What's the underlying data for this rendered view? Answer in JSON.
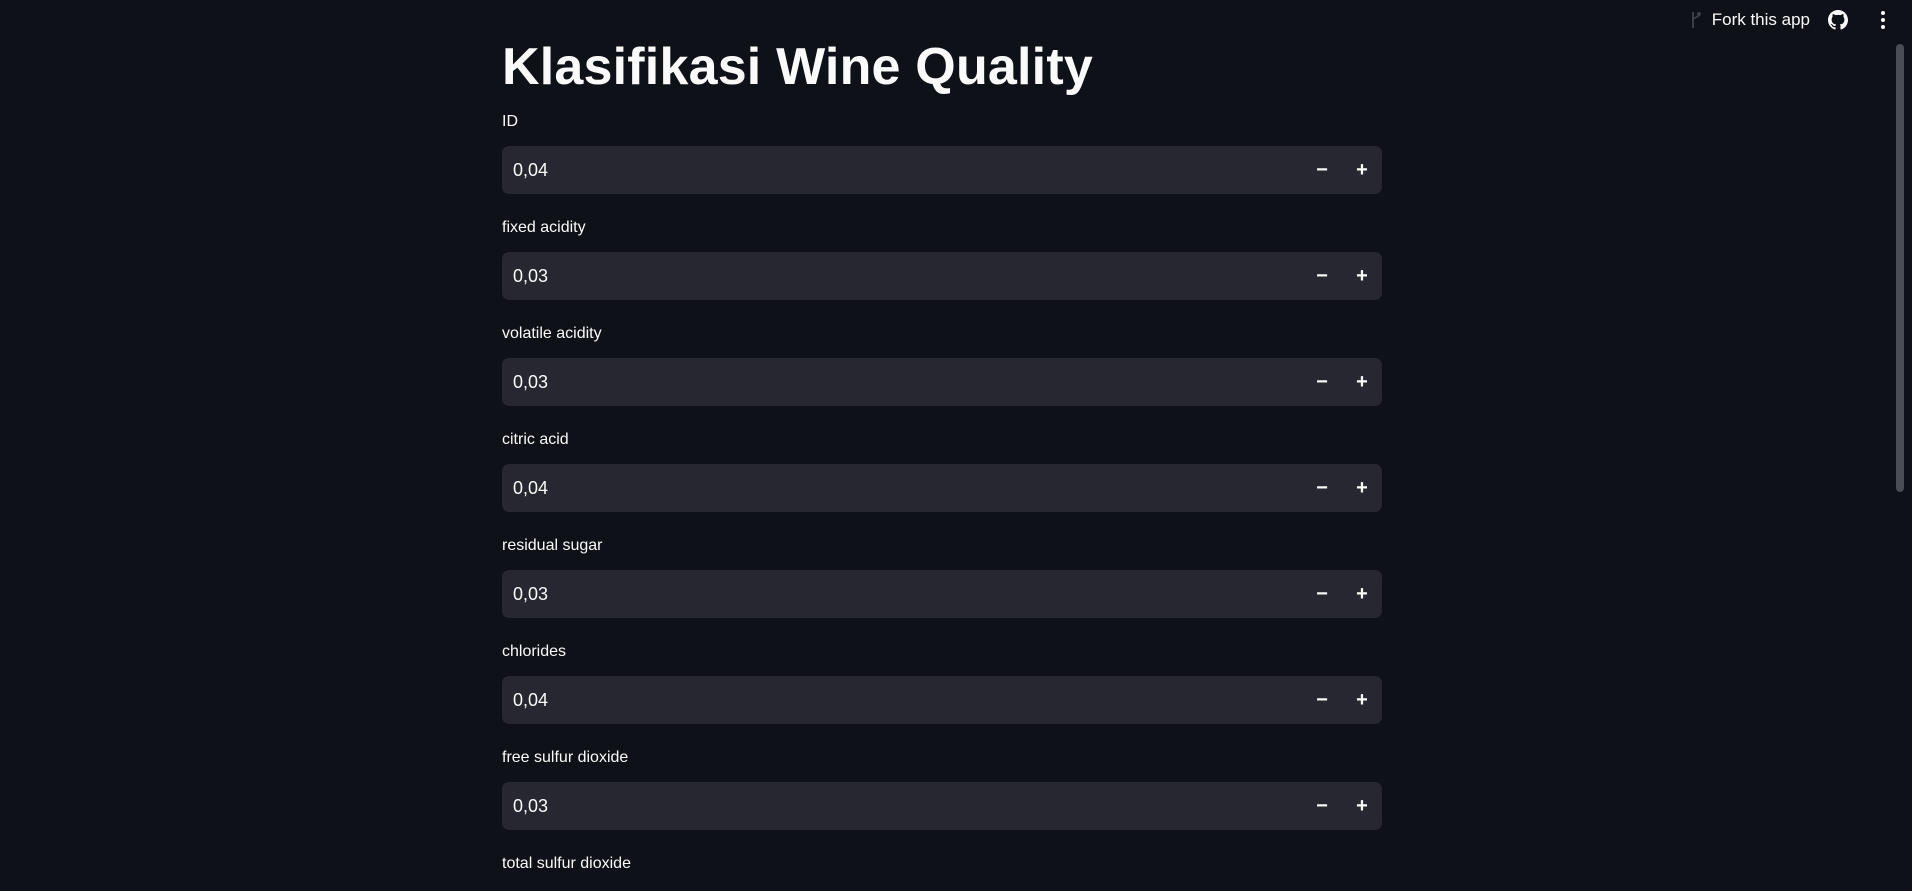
{
  "toolbar": {
    "fork_label": "Fork this app"
  },
  "page": {
    "title": "Klasifikasi Wine Quality"
  },
  "fields": [
    {
      "label": "ID",
      "value": "0,04"
    },
    {
      "label": "fixed acidity",
      "value": "0,03"
    },
    {
      "label": "volatile acidity",
      "value": "0,03"
    },
    {
      "label": "citric acid",
      "value": "0,04"
    },
    {
      "label": "residual sugar",
      "value": "0,03"
    },
    {
      "label": "chlorides",
      "value": "0,04"
    },
    {
      "label": "free sulfur dioxide",
      "value": "0,03"
    },
    {
      "label": "total sulfur dioxide",
      "value": ""
    }
  ],
  "stepper": {
    "minus": "−",
    "plus": "+"
  },
  "icons": {
    "fork": "fork-icon",
    "github": "github-icon",
    "menu": "kebab-menu-icon",
    "minus": "minus-icon",
    "plus": "plus-icon"
  },
  "colors": {
    "background": "#0e1117",
    "input_background": "#262730",
    "text": "#fafafa",
    "scrollbar": "#4a4d55"
  }
}
